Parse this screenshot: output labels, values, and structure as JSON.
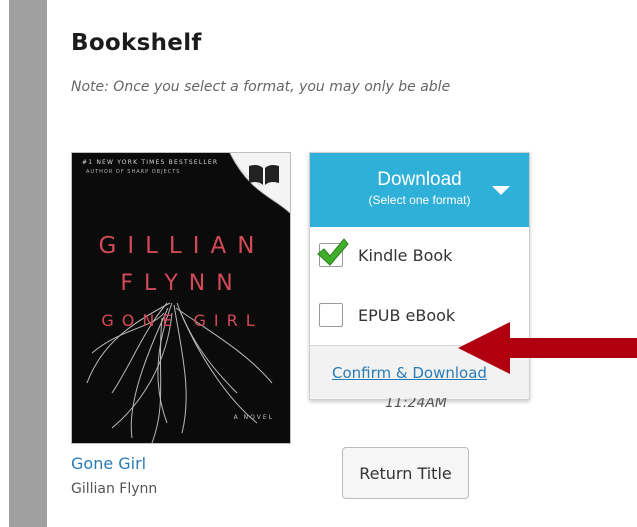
{
  "bookshelf": {
    "title": "Bookshelf",
    "note": "Note: Once you select a format, you may only be able"
  },
  "book": {
    "cover": {
      "top_text": "#1 NEW YORK TIMES BESTSELLER",
      "sub_text": "AUTHOR OF SHARP OBJECTS",
      "author_line_1": "GILLIAN",
      "author_line_2": "FLYNN",
      "title_line": "GONE GIRL",
      "novel_text": "A NOVEL"
    },
    "title": "Gone Girl",
    "author": "Gillian Flynn",
    "badge_icon": "open-book-icon"
  },
  "download": {
    "button_label": "Download",
    "button_sublabel": "(Select one format)",
    "formats": [
      {
        "label": "Kindle Book",
        "checked": true
      },
      {
        "label": "EPUB eBook",
        "checked": false
      }
    ],
    "confirm_label": "Confirm & Download",
    "expire_time": "11:24AM"
  },
  "return_button_label": "Return Title",
  "colors": {
    "accent": "#2fb0d8",
    "link": "#2a7bb5",
    "arrow": "#b0000f",
    "side_bar": "#a0a0a0"
  }
}
